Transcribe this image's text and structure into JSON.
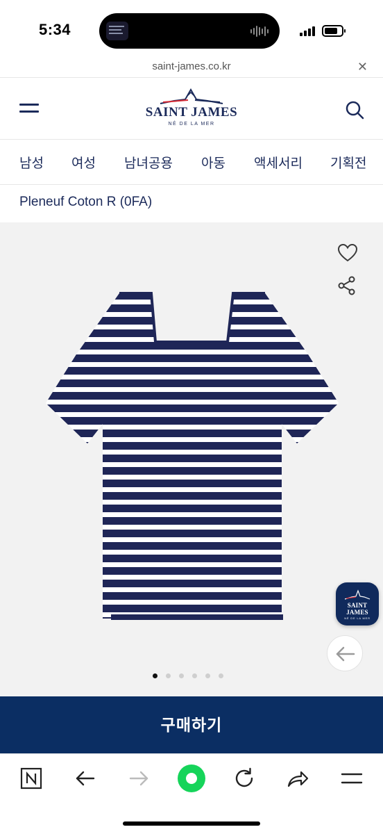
{
  "status_bar": {
    "time": "5:34"
  },
  "browser": {
    "url": "saint-james.co.kr",
    "close_icon": "close-icon"
  },
  "header": {
    "menu_icon": "hamburger-menu-icon",
    "logo_name": "SAINT JAMES",
    "logo_tagline": "NÉ DE LA MER",
    "search_icon": "search-icon"
  },
  "categories": [
    {
      "label": "남성"
    },
    {
      "label": "여성"
    },
    {
      "label": "남녀공용"
    },
    {
      "label": "아동"
    },
    {
      "label": "액세서리"
    },
    {
      "label": "기획전"
    }
  ],
  "product": {
    "title": "Pleneuf Coton R (0FA)",
    "image_description_icon": "striped-tshirt-image",
    "image_count": 6,
    "active_image_index": 0,
    "wishlist_icon": "heart-icon",
    "share_icon": "share-icon",
    "stripe_colors": {
      "navy": "#1f2657",
      "white": "#ffffff"
    }
  },
  "floating": {
    "logo_name": "SAINT JAMES",
    "logo_tagline": "NÉ DE LA MER",
    "back_icon": "arrow-left-icon"
  },
  "buy_button": {
    "label": "구매하기",
    "color": "#0b2e63"
  },
  "toolbar": {
    "items": [
      {
        "icon": "naver-n-icon"
      },
      {
        "icon": "back-arrow-icon"
      },
      {
        "icon": "forward-arrow-icon"
      },
      {
        "icon": "green-record-icon",
        "color": "#16d45a"
      },
      {
        "icon": "reload-icon"
      },
      {
        "icon": "share-arrow-icon"
      },
      {
        "icon": "menu-icon"
      }
    ]
  }
}
